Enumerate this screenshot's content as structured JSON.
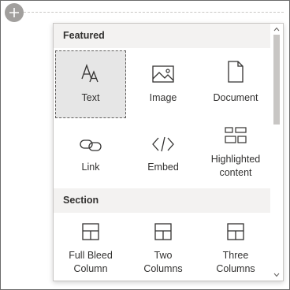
{
  "featured": {
    "title": "Featured",
    "items": [
      {
        "label": "Text",
        "icon": "text-icon"
      },
      {
        "label": "Image",
        "icon": "image-icon"
      },
      {
        "label": "Document",
        "icon": "document-icon"
      },
      {
        "label": "Link",
        "icon": "link-icon"
      },
      {
        "label": "Embed",
        "icon": "embed-icon"
      },
      {
        "label": "Highlighted\ncontent",
        "icon": "highlighted-content-icon"
      }
    ]
  },
  "section": {
    "title": "Section",
    "items": [
      {
        "label": "Full Bleed\nColumn",
        "icon": "full-bleed-column-icon"
      },
      {
        "label": "Two\nColumns",
        "icon": "two-columns-icon"
      },
      {
        "label": "Three\nColumns",
        "icon": "three-columns-icon"
      }
    ]
  },
  "colors": {
    "selected_tile": "#e6e6e6",
    "header_bg": "#f3f2f1",
    "add_button": "#a19f9d"
  }
}
